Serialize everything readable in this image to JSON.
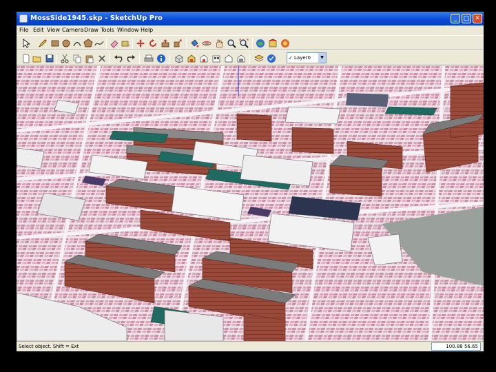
{
  "window": {
    "title": "MossSide1945.skp - SketchUp Pro",
    "controls": {
      "minimize": "_",
      "maximize": "□",
      "close": "✕"
    }
  },
  "menu": [
    "File",
    "Edit",
    "View",
    "Camera",
    "Draw",
    "Tools",
    "Window",
    "Help"
  ],
  "toolbar1": [
    "select-icon",
    "pencil-icon",
    "rectangle-icon",
    "circle-icon",
    "arc-icon",
    "polygon-icon",
    "freehand-icon",
    "eraser-icon",
    "tape-measure-icon",
    "move-icon",
    "rotate-icon",
    "push-pull-icon",
    "scale-icon",
    "paint-bucket-icon",
    "orbit-icon",
    "pan-icon",
    "zoom-icon",
    "zoom-extents-icon",
    "3d-warehouse-icon",
    "components-icon"
  ],
  "toolbar2": [
    "new-icon",
    "open-icon",
    "cut-icon",
    "copy-icon",
    "paste-icon",
    "erase-icon",
    "undo-icon",
    "redo-icon",
    "print-icon",
    "model-info-icon",
    "iso-view-icon",
    "top-view-icon",
    "front-view-icon",
    "right-view-icon",
    "back-view-icon",
    "left-view-icon",
    "layers-icon"
  ],
  "layer_select": {
    "check": "✓",
    "value": "Layer0",
    "arrow": "▼"
  },
  "status": {
    "text": "Select object. Shift = Ext",
    "measurement": "100.88 56.65"
  },
  "colors": {
    "title_bar": "#0a4bd6",
    "chrome": "#ece9d8",
    "ground": "#f1e6ec",
    "brick_roof": "#9a4a3a",
    "slate_roof": "#7b7b7b",
    "teal_roof": "#1f6b61",
    "white_block": "#f2f2f2",
    "navy_block": "#2b3550"
  }
}
